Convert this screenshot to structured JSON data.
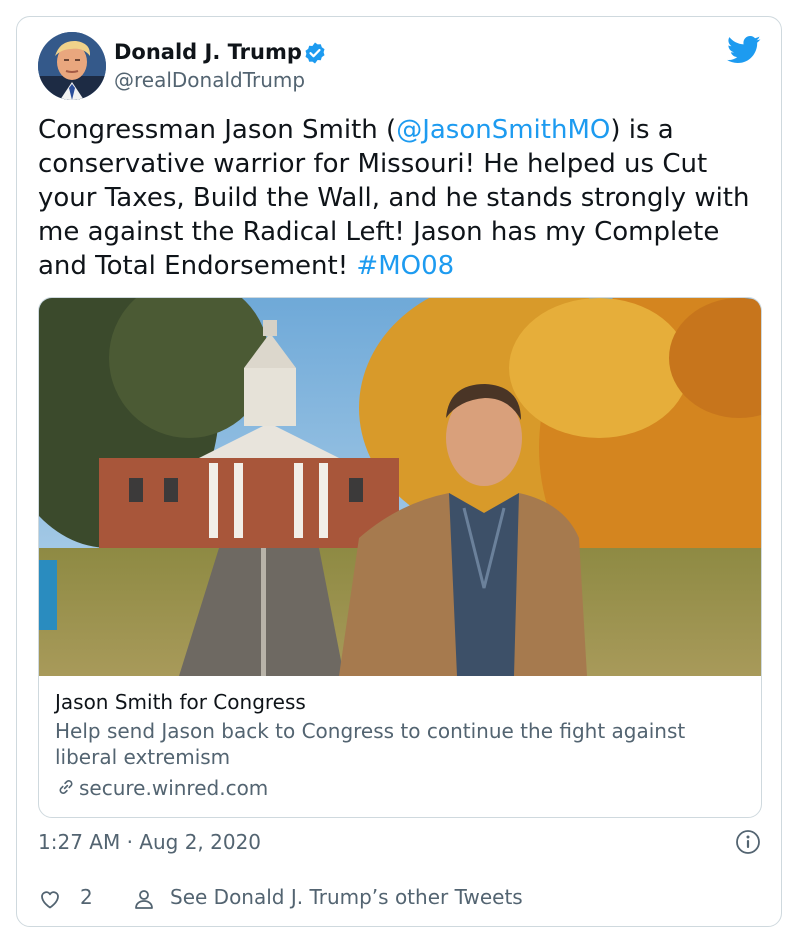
{
  "author": {
    "display_name": "Donald J. Trump",
    "handle": "@realDonaldTrump",
    "avatar_icon": "avatar-portrait",
    "verified_icon": "verified-badge-icon",
    "brand_icon": "twitter-bird-icon"
  },
  "tweet": {
    "text_1": "Congressman Jason Smith (",
    "mention": "@JasonSmithMO",
    "text_2": ") is a conservative warrior for Missouri! He helped us Cut your Taxes, Build the Wall, and he stands strongly with me against the Radical Left! Jason has my Complete and Total Endorsement! ",
    "hashtag": "#MO08"
  },
  "link_card": {
    "title": "Jason Smith for Congress",
    "description": "Help send Jason back to Congress to continue the fight against liberal extremism",
    "domain": "secure.winred.com",
    "domain_icon": "link-icon",
    "image_icon": "campaign-photo"
  },
  "meta": {
    "timestamp": "1:27 AM · Aug 2, 2020",
    "info_icon": "info-icon"
  },
  "actions": {
    "like_count": "2",
    "like_icon": "heart-icon",
    "other_tweets_label": "See Donald J. Trump’s other Tweets",
    "other_tweets_icon": "person-icon"
  },
  "colors": {
    "accent": "#1d9bf0",
    "text": "#0f1419",
    "secondary": "#536471",
    "border": "#cfd9de"
  }
}
